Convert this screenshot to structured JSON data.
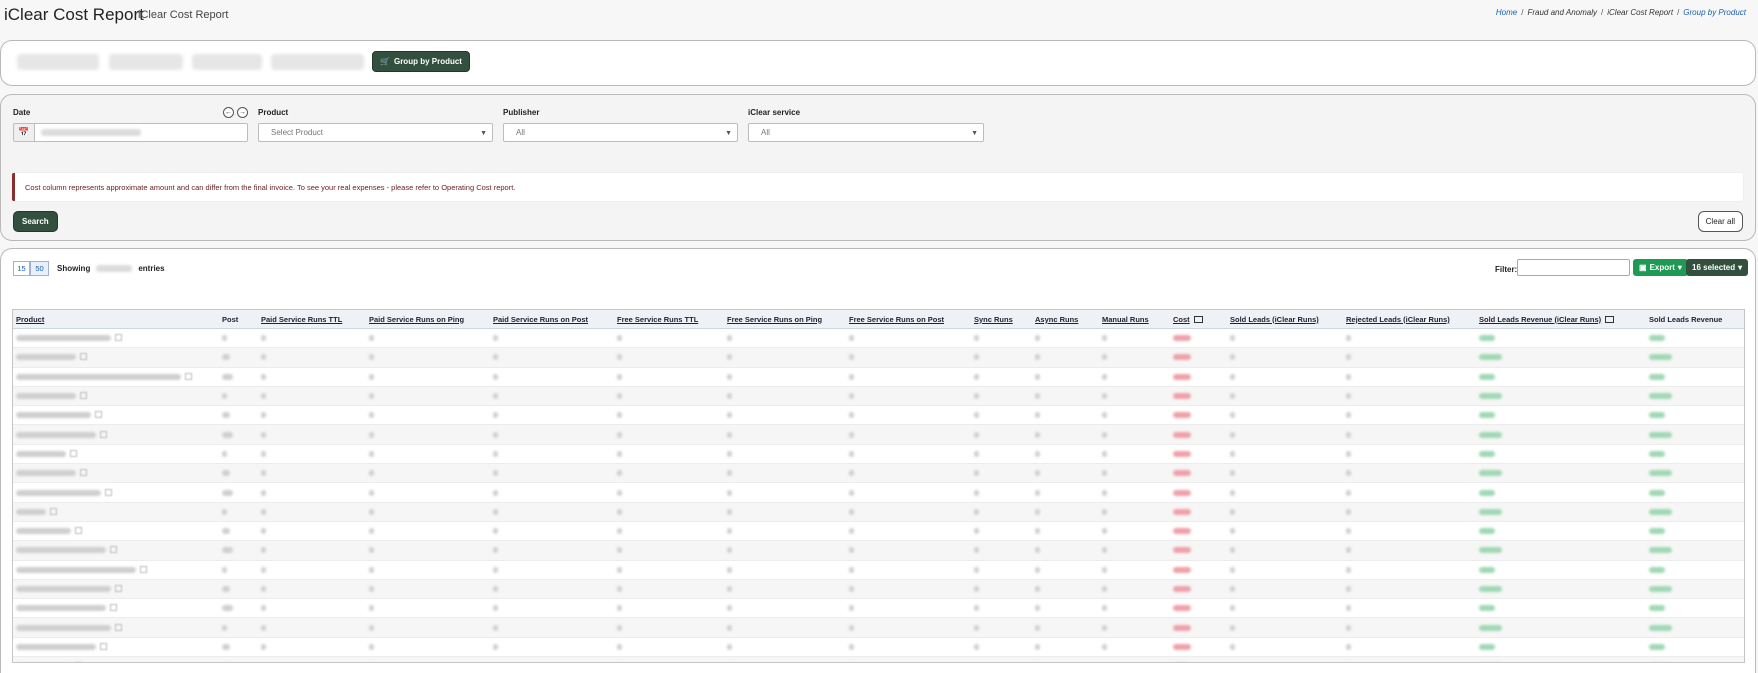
{
  "header": {
    "title": "iClear Cost Report",
    "subtitle": "iClear Cost Report",
    "breadcrumb": [
      "Home",
      "Fraud and Anomaly",
      "iClear Cost Report",
      "Group by Product"
    ]
  },
  "tabs": {
    "active_label": "Group by Product"
  },
  "filters": {
    "date_label": "Date",
    "product_label": "Product",
    "product_placeholder": "Select Product",
    "publisher_label": "Publisher",
    "publisher_value": "All",
    "service_label": "iClear service",
    "service_value": "All",
    "notice": "Cost column represents approximate amount and can differ from the final invoice. To see your real expenses - please refer to Operating Cost report.",
    "search_label": "Search",
    "clear_label": "Clear all"
  },
  "table_controls": {
    "page_sizes": [
      "15",
      "50"
    ],
    "showing_label": "Showing",
    "entries_label": "entries",
    "filter_label": "Filter:",
    "export_label": "Export",
    "columns_label": "16 selected"
  },
  "table": {
    "columns": [
      "Product",
      "Post",
      "Paid Service Runs TTL",
      "Paid Service Runs on Ping",
      "Paid Service Runs on Post",
      "Free Service Runs TTL",
      "Free Service Runs on Ping",
      "Free Service Runs on Post",
      "Sync Runs",
      "Async Runs",
      "Manual Runs",
      "Cost",
      "Sold Leads (iClear Runs)",
      "Rejected Leads (iClear Runs)",
      "Sold Leads Revenue (iClear Runs)",
      "Sold Leads Revenue"
    ]
  }
}
